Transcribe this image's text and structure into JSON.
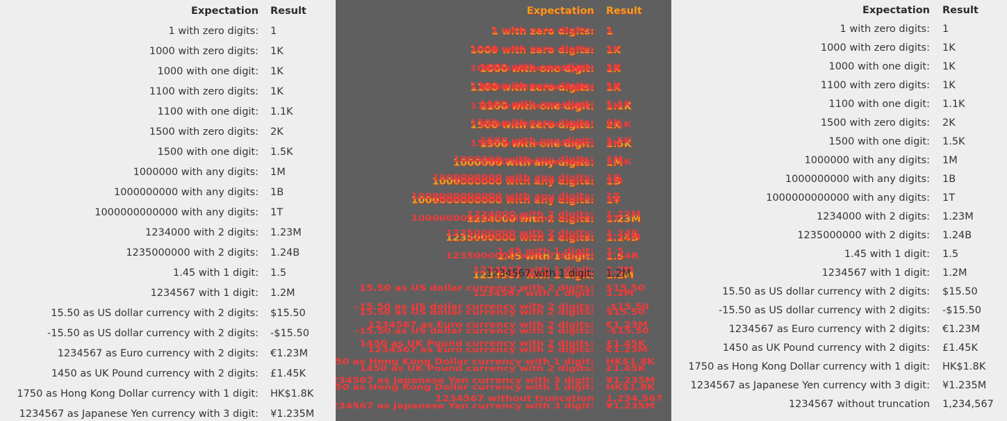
{
  "headers": {
    "expectation": "Expectation",
    "result": "Result"
  },
  "rows": [
    {
      "label": "1 with zero digits:",
      "result": "1"
    },
    {
      "label": "1000 with zero digits:",
      "result": "1K"
    },
    {
      "label": "1000 with one digit:",
      "result": "1K"
    },
    {
      "label": "1100 with zero digits:",
      "result": "1K"
    },
    {
      "label": "1100 with one digit:",
      "result": "1.1K"
    },
    {
      "label": "1500 with zero digits:",
      "result": "2K"
    },
    {
      "label": "1500 with one digit:",
      "result": "1.5K"
    },
    {
      "label": "1000000 with any digits:",
      "result": "1M"
    },
    {
      "label": "1000000000 with any digits:",
      "result": "1B"
    },
    {
      "label": "1000000000000 with any digits:",
      "result": "1T"
    },
    {
      "label": "1234000 with 2 digits:",
      "result": "1.23M"
    },
    {
      "label": "1235000000 with 2 digits:",
      "result": "1.24B"
    },
    {
      "label": "1.45 with 1 digit:",
      "result": "1.5"
    },
    {
      "label": "1234567 with 1 digit:",
      "result": "1.2M"
    },
    {
      "label": "15.50 as US dollar currency with 2 digits:",
      "result": "$15.50"
    },
    {
      "label": "-15.50 as US dollar currency with 2 digits:",
      "result": "-$15.50"
    },
    {
      "label": "1234567 as Euro currency with 2 digits:",
      "result": "€1.23M"
    },
    {
      "label": "1450 as UK Pound currency with 2 digits:",
      "result": "£1.45K"
    },
    {
      "label": "1750 as Hong Kong Dollar currency with 1 digit:",
      "result": "HK$1.8K"
    },
    {
      "label": "1234567 as Japanese Yen currency with 3 digit:",
      "result": "¥1.235M"
    },
    {
      "label": "1234567 without truncation",
      "result": "1,234,567"
    }
  ]
}
